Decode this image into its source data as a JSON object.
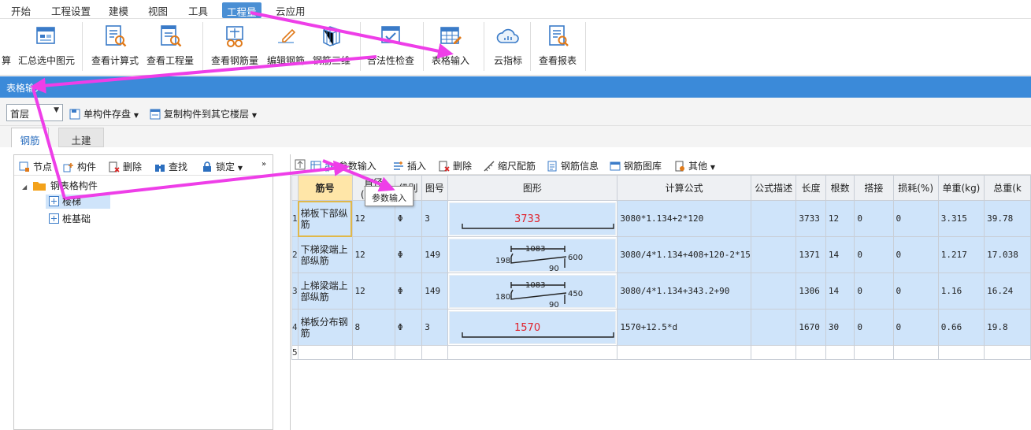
{
  "menubar": {
    "items": [
      "开始",
      "工程设置",
      "建模",
      "视图",
      "工具",
      "工程量",
      "云应用"
    ],
    "active_index": 5
  },
  "ribbon": {
    "buttons": [
      {
        "label": "算",
        "icon": "calc-icon"
      },
      {
        "label": "汇总选中图元",
        "icon": "summary-selected-icon"
      },
      {
        "label": "查看计算式",
        "icon": "view-formula-icon"
      },
      {
        "label": "查看工程量",
        "icon": "view-quantity-icon"
      },
      {
        "label": "查看钢筋量",
        "icon": "view-rebar-icon"
      },
      {
        "label": "编辑钢筋",
        "icon": "edit-rebar-icon"
      },
      {
        "label": "钢筋三维",
        "icon": "rebar-3d-icon"
      },
      {
        "label": "合法性检查",
        "icon": "validity-check-icon"
      },
      {
        "label": "表格输入",
        "icon": "table-input-icon"
      },
      {
        "label": "云指标",
        "icon": "cloud-index-icon"
      },
      {
        "label": "查看报表",
        "icon": "view-report-icon"
      }
    ]
  },
  "panel_title": "表格输入",
  "toolbar": {
    "floor_value": "首层",
    "save_component": "单构件存盘",
    "copy_component": "复制构件到其它楼层"
  },
  "tabs": [
    "钢筋",
    "土建"
  ],
  "left_toolbar": {
    "node": "节点",
    "component": "构件",
    "delete": "删除",
    "find": "查找",
    "lock": "锁定"
  },
  "tree": {
    "root": "钢筋表格构件",
    "root_visible": "表格构件",
    "children": [
      "楼梯",
      "桩基础"
    ]
  },
  "right_toolbar": {
    "param_input": "参数输入",
    "insert": "插入",
    "delete": "删除",
    "scale_rebar": "缩尺配筋",
    "rebar_info": "钢筋信息",
    "rebar_library": "钢筋图库",
    "other": "其他"
  },
  "table": {
    "columns": [
      "筋号",
      "直径(mm)",
      "级别",
      "图号",
      "图形",
      "计算公式",
      "公式描述",
      "长度",
      "根数",
      "搭接",
      "损耗(%)",
      "单重(kg)",
      "总重(k"
    ],
    "rows": [
      {
        "no": "1",
        "name": "梯板下部纵筋",
        "diameter": "12",
        "grade": "Φ",
        "fig": "3",
        "formula": "3080*1.134+2*120",
        "desc": "",
        "length": "3733",
        "count": "12",
        "lap": "0",
        "loss": "0",
        "unit_weight": "3.315",
        "total_weight": "39.78",
        "shape": {
          "kind": "straight",
          "main": "3733"
        }
      },
      {
        "no": "2",
        "name": "下梯梁端上部纵筋",
        "diameter": "12",
        "grade": "Φ",
        "fig": "149",
        "formula": "3080/4*1.134+408+120-2*15",
        "desc": "",
        "length": "1371",
        "count": "14",
        "lap": "0",
        "loss": "0",
        "unit_weight": "1.217",
        "total_weight": "17.038",
        "shape": {
          "kind": "bent",
          "top": "1083",
          "left": "198",
          "right": "600",
          "bottom": "90"
        }
      },
      {
        "no": "3",
        "name": "上梯梁端上部纵筋",
        "diameter": "12",
        "grade": "Φ",
        "fig": "149",
        "formula": "3080/4*1.134+343.2+90",
        "desc": "",
        "length": "1306",
        "count": "14",
        "lap": "0",
        "loss": "0",
        "unit_weight": "1.16",
        "total_weight": "16.24",
        "shape": {
          "kind": "bent",
          "top": "1083",
          "left": "180",
          "right": "450",
          "bottom": "90"
        }
      },
      {
        "no": "4",
        "name": "梯板分布钢筋",
        "diameter": "8",
        "grade": "Φ",
        "fig": "3",
        "formula": "1570+12.5*d",
        "desc": "",
        "length": "1670",
        "count": "30",
        "lap": "0",
        "loss": "0",
        "unit_weight": "0.66",
        "total_weight": "19.8",
        "shape": {
          "kind": "straight",
          "main": "1570"
        }
      },
      {
        "no": "5",
        "name": "",
        "diameter": "",
        "grade": "",
        "fig": "",
        "formula": "",
        "desc": "",
        "length": "",
        "count": "",
        "lap": "",
        "loss": "",
        "unit_weight": "",
        "total_weight": ""
      }
    ]
  },
  "tooltip": "参数输入",
  "colors": {
    "accent": "#3b8ad9",
    "selected_row": "#cfe4fa",
    "annotation_arrow": "#ee3ee8",
    "shape_red": "#e0202a"
  }
}
